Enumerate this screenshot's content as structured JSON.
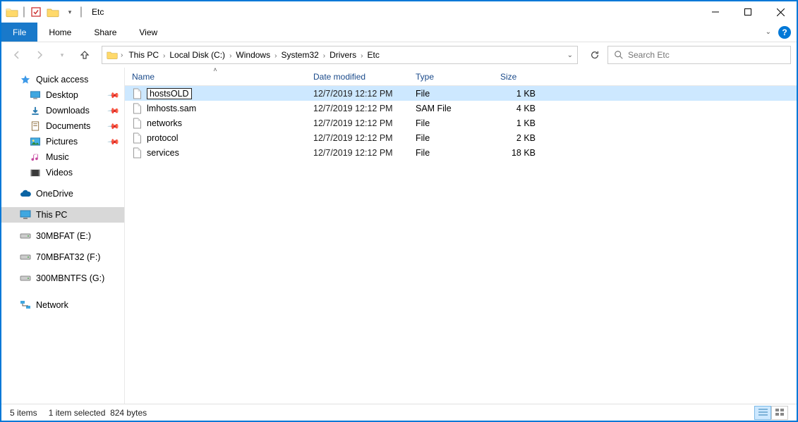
{
  "window": {
    "title": "Etc"
  },
  "menubar": {
    "file": "File",
    "items": [
      "Home",
      "Share",
      "View"
    ]
  },
  "breadcrumbs": [
    "This PC",
    "Local Disk (C:)",
    "Windows",
    "System32",
    "Drivers",
    "Etc"
  ],
  "search": {
    "placeholder": "Search Etc"
  },
  "columns": {
    "name": "Name",
    "date": "Date modified",
    "type": "Type",
    "size": "Size"
  },
  "sidebar": {
    "quick_access": "Quick access",
    "quick_items": [
      {
        "label": "Desktop",
        "pinned": true
      },
      {
        "label": "Downloads",
        "pinned": true
      },
      {
        "label": "Documents",
        "pinned": true
      },
      {
        "label": "Pictures",
        "pinned": true
      },
      {
        "label": "Music",
        "pinned": false
      },
      {
        "label": "Videos",
        "pinned": false
      }
    ],
    "onedrive": "OneDrive",
    "this_pc": "This PC",
    "drives": [
      "30MBFAT (E:)",
      "70MBFAT32 (F:)",
      "300MBNTFS (G:)"
    ],
    "network": "Network"
  },
  "files": [
    {
      "name": "hostsOLD",
      "date": "12/7/2019 12:12 PM",
      "type": "File",
      "size": "1 KB",
      "selected": true,
      "renaming": true
    },
    {
      "name": "lmhosts.sam",
      "date": "12/7/2019 12:12 PM",
      "type": "SAM File",
      "size": "4 KB"
    },
    {
      "name": "networks",
      "date": "12/7/2019 12:12 PM",
      "type": "File",
      "size": "1 KB"
    },
    {
      "name": "protocol",
      "date": "12/7/2019 12:12 PM",
      "type": "File",
      "size": "2 KB"
    },
    {
      "name": "services",
      "date": "12/7/2019 12:12 PM",
      "type": "File",
      "size": "18 KB"
    }
  ],
  "status": {
    "count": "5 items",
    "selection": "1 item selected",
    "bytes": "824 bytes"
  }
}
